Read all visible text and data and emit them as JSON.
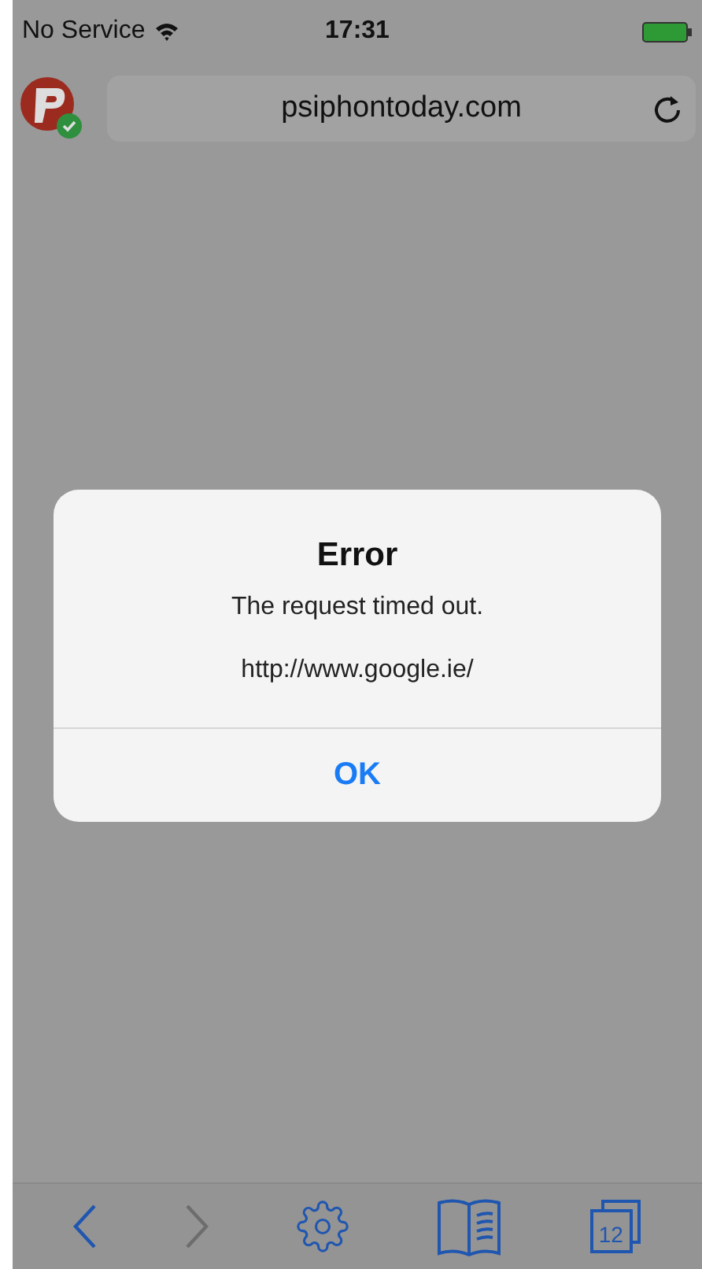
{
  "status_bar": {
    "carrier": "No Service",
    "time": "17:31"
  },
  "address_bar": {
    "url": "psiphontoday.com",
    "connected": true
  },
  "alert": {
    "title": "Error",
    "message": "The request timed out.",
    "detail": "http://www.google.ie/",
    "buttons": [
      "OK"
    ]
  },
  "toolbar": {
    "items": [
      {
        "kind": "back",
        "disabled": false
      },
      {
        "kind": "forward",
        "disabled": true
      },
      {
        "kind": "settings",
        "disabled": false
      },
      {
        "kind": "bookmarks",
        "disabled": false
      },
      {
        "kind": "tabs",
        "label": "12",
        "disabled": false
      }
    ]
  }
}
